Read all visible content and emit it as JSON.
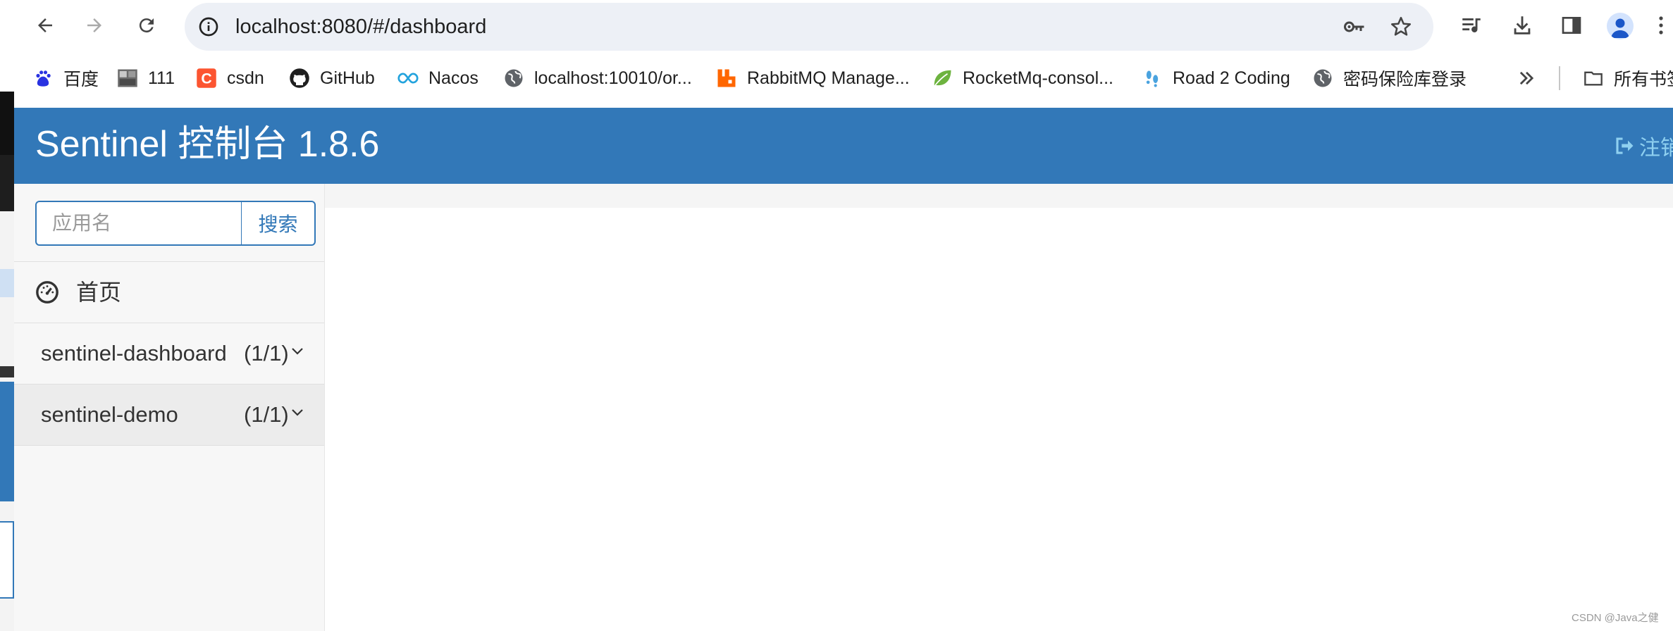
{
  "browser": {
    "url": "localhost:8080/#/dashboard",
    "bookmarks": [
      {
        "icon": "baidu-icon",
        "label": "百度"
      },
      {
        "icon": "photo-icon",
        "label": "111"
      },
      {
        "icon": "csdn-icon",
        "label": "csdn"
      },
      {
        "icon": "github-icon",
        "label": "GitHub"
      },
      {
        "icon": "nacos-icon",
        "label": "Nacos"
      },
      {
        "icon": "globe-icon",
        "label": "localhost:10010/or..."
      },
      {
        "icon": "rabbitmq-icon",
        "label": "RabbitMQ Manage..."
      },
      {
        "icon": "leaf-icon",
        "label": "RocketMq-consol..."
      },
      {
        "icon": "footprint-icon",
        "label": "Road 2 Coding"
      },
      {
        "icon": "globe-icon",
        "label": "密码保险库登录"
      }
    ],
    "all_bookmarks_label": "所有书签"
  },
  "app": {
    "title": "Sentinel 控制台 1.8.6",
    "logout_label": "注销",
    "search": {
      "placeholder": "应用名",
      "button_label": "搜索"
    },
    "home_label": "首页",
    "applications": [
      {
        "name": "sentinel-dashboard",
        "count": "(1/1)"
      },
      {
        "name": "sentinel-demo",
        "count": "(1/1)"
      }
    ]
  },
  "watermark": "CSDN @Java之健",
  "colors": {
    "header": "#3278b8",
    "accent": "#3278b8",
    "sidebar_bg": "#f7f7f7"
  }
}
